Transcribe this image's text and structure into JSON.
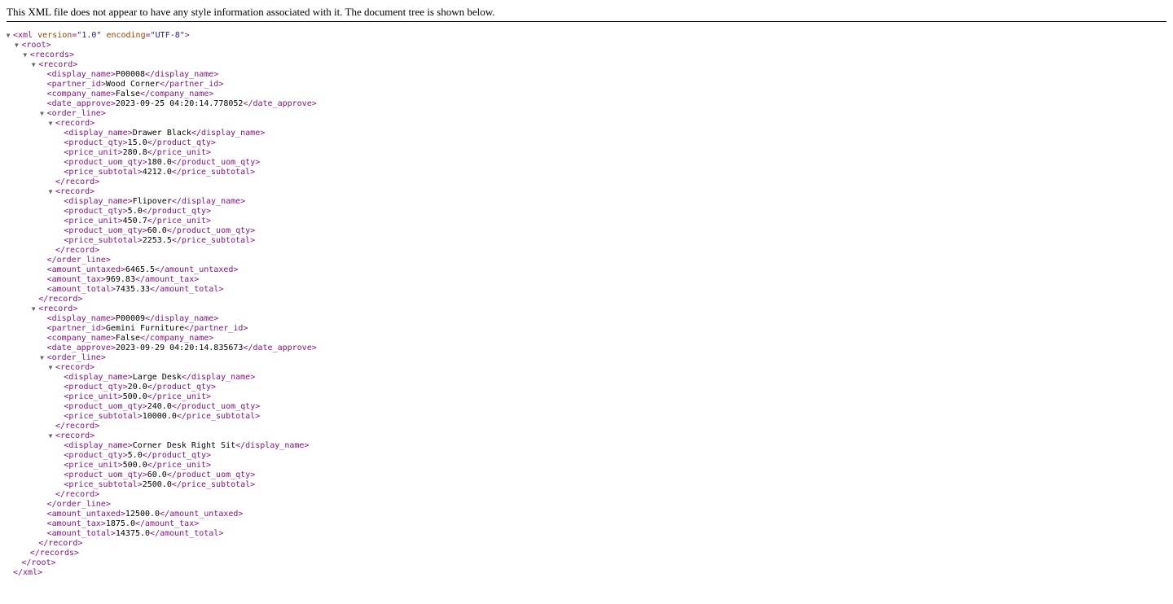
{
  "header": {
    "message": "This XML file does not appear to have any style information associated with it. The document tree is shown below."
  },
  "colors": {
    "tag": "#881280",
    "attribute_name": "#994500",
    "attribute_value": "#1a1aa6",
    "text": "#000000",
    "toggle_arrow": "#666666"
  },
  "icons": {
    "expanded_toggle": "expanded-triangle-icon"
  },
  "toggle_glyph": "▼",
  "lines": [
    {
      "depth": 0,
      "toggle": true,
      "parts": [
        {
          "t": "tag",
          "v": "<xml "
        },
        {
          "t": "attr-name",
          "v": "version"
        },
        {
          "t": "tag",
          "v": "="
        },
        {
          "t": "attr-value",
          "v": "\"1.0\""
        },
        {
          "t": "tag",
          "v": " "
        },
        {
          "t": "attr-name",
          "v": "encoding"
        },
        {
          "t": "tag",
          "v": "="
        },
        {
          "t": "attr-value",
          "v": "\"UTF-8\""
        },
        {
          "t": "tag",
          "v": ">"
        }
      ]
    },
    {
      "depth": 1,
      "toggle": true,
      "parts": [
        {
          "t": "tag",
          "v": "<root>"
        }
      ]
    },
    {
      "depth": 2,
      "toggle": true,
      "parts": [
        {
          "t": "tag",
          "v": "<records>"
        }
      ]
    },
    {
      "depth": 3,
      "toggle": true,
      "parts": [
        {
          "t": "tag",
          "v": "<record>"
        }
      ]
    },
    {
      "depth": 4,
      "toggle": false,
      "parts": [
        {
          "t": "tag",
          "v": "<display_name>"
        },
        {
          "t": "text",
          "v": "P00008"
        },
        {
          "t": "tag",
          "v": "</display_name>"
        }
      ]
    },
    {
      "depth": 4,
      "toggle": false,
      "parts": [
        {
          "t": "tag",
          "v": "<partner_id>"
        },
        {
          "t": "text",
          "v": "Wood Corner"
        },
        {
          "t": "tag",
          "v": "</partner_id>"
        }
      ]
    },
    {
      "depth": 4,
      "toggle": false,
      "parts": [
        {
          "t": "tag",
          "v": "<company_name>"
        },
        {
          "t": "text",
          "v": "False"
        },
        {
          "t": "tag",
          "v": "</company_name>"
        }
      ]
    },
    {
      "depth": 4,
      "toggle": false,
      "parts": [
        {
          "t": "tag",
          "v": "<date_approve>"
        },
        {
          "t": "text",
          "v": "2023-09-25 04:20:14.778052"
        },
        {
          "t": "tag",
          "v": "</date_approve>"
        }
      ]
    },
    {
      "depth": 4,
      "toggle": true,
      "parts": [
        {
          "t": "tag",
          "v": "<order_line>"
        }
      ]
    },
    {
      "depth": 5,
      "toggle": true,
      "parts": [
        {
          "t": "tag",
          "v": "<record>"
        }
      ]
    },
    {
      "depth": 6,
      "toggle": false,
      "parts": [
        {
          "t": "tag",
          "v": "<display_name>"
        },
        {
          "t": "text",
          "v": "Drawer Black"
        },
        {
          "t": "tag",
          "v": "</display_name>"
        }
      ]
    },
    {
      "depth": 6,
      "toggle": false,
      "parts": [
        {
          "t": "tag",
          "v": "<product_qty>"
        },
        {
          "t": "text",
          "v": "15.0"
        },
        {
          "t": "tag",
          "v": "</product_qty>"
        }
      ]
    },
    {
      "depth": 6,
      "toggle": false,
      "parts": [
        {
          "t": "tag",
          "v": "<price_unit>"
        },
        {
          "t": "text",
          "v": "280.8"
        },
        {
          "t": "tag",
          "v": "</price_unit>"
        }
      ]
    },
    {
      "depth": 6,
      "toggle": false,
      "parts": [
        {
          "t": "tag",
          "v": "<product_uom_qty>"
        },
        {
          "t": "text",
          "v": "180.0"
        },
        {
          "t": "tag",
          "v": "</product_uom_qty>"
        }
      ]
    },
    {
      "depth": 6,
      "toggle": false,
      "parts": [
        {
          "t": "tag",
          "v": "<price_subtotal>"
        },
        {
          "t": "text",
          "v": "4212.0"
        },
        {
          "t": "tag",
          "v": "</price_subtotal>"
        }
      ]
    },
    {
      "depth": 5,
      "toggle": false,
      "parts": [
        {
          "t": "tag",
          "v": "</record>"
        }
      ]
    },
    {
      "depth": 5,
      "toggle": true,
      "parts": [
        {
          "t": "tag",
          "v": "<record>"
        }
      ]
    },
    {
      "depth": 6,
      "toggle": false,
      "parts": [
        {
          "t": "tag",
          "v": "<display_name>"
        },
        {
          "t": "text",
          "v": "Flipover"
        },
        {
          "t": "tag",
          "v": "</display_name>"
        }
      ]
    },
    {
      "depth": 6,
      "toggle": false,
      "parts": [
        {
          "t": "tag",
          "v": "<product_qty>"
        },
        {
          "t": "text",
          "v": "5.0"
        },
        {
          "t": "tag",
          "v": "</product_qty>"
        }
      ]
    },
    {
      "depth": 6,
      "toggle": false,
      "parts": [
        {
          "t": "tag",
          "v": "<price_unit>"
        },
        {
          "t": "text",
          "v": "450.7"
        },
        {
          "t": "tag",
          "v": "</price_unit>"
        }
      ]
    },
    {
      "depth": 6,
      "toggle": false,
      "parts": [
        {
          "t": "tag",
          "v": "<product_uom_qty>"
        },
        {
          "t": "text",
          "v": "60.0"
        },
        {
          "t": "tag",
          "v": "</product_uom_qty>"
        }
      ]
    },
    {
      "depth": 6,
      "toggle": false,
      "parts": [
        {
          "t": "tag",
          "v": "<price_subtotal>"
        },
        {
          "t": "text",
          "v": "2253.5"
        },
        {
          "t": "tag",
          "v": "</price_subtotal>"
        }
      ]
    },
    {
      "depth": 5,
      "toggle": false,
      "parts": [
        {
          "t": "tag",
          "v": "</record>"
        }
      ]
    },
    {
      "depth": 4,
      "toggle": false,
      "parts": [
        {
          "t": "tag",
          "v": "</order_line>"
        }
      ]
    },
    {
      "depth": 4,
      "toggle": false,
      "parts": [
        {
          "t": "tag",
          "v": "<amount_untaxed>"
        },
        {
          "t": "text",
          "v": "6465.5"
        },
        {
          "t": "tag",
          "v": "</amount_untaxed>"
        }
      ]
    },
    {
      "depth": 4,
      "toggle": false,
      "parts": [
        {
          "t": "tag",
          "v": "<amount_tax>"
        },
        {
          "t": "text",
          "v": "969.83"
        },
        {
          "t": "tag",
          "v": "</amount_tax>"
        }
      ]
    },
    {
      "depth": 4,
      "toggle": false,
      "parts": [
        {
          "t": "tag",
          "v": "<amount_total>"
        },
        {
          "t": "text",
          "v": "7435.33"
        },
        {
          "t": "tag",
          "v": "</amount_total>"
        }
      ]
    },
    {
      "depth": 3,
      "toggle": false,
      "parts": [
        {
          "t": "tag",
          "v": "</record>"
        }
      ]
    },
    {
      "depth": 3,
      "toggle": true,
      "parts": [
        {
          "t": "tag",
          "v": "<record>"
        }
      ]
    },
    {
      "depth": 4,
      "toggle": false,
      "parts": [
        {
          "t": "tag",
          "v": "<display_name>"
        },
        {
          "t": "text",
          "v": "P00009"
        },
        {
          "t": "tag",
          "v": "</display_name>"
        }
      ]
    },
    {
      "depth": 4,
      "toggle": false,
      "parts": [
        {
          "t": "tag",
          "v": "<partner_id>"
        },
        {
          "t": "text",
          "v": "Gemini Furniture"
        },
        {
          "t": "tag",
          "v": "</partner_id>"
        }
      ]
    },
    {
      "depth": 4,
      "toggle": false,
      "parts": [
        {
          "t": "tag",
          "v": "<company_name>"
        },
        {
          "t": "text",
          "v": "False"
        },
        {
          "t": "tag",
          "v": "</company_name>"
        }
      ]
    },
    {
      "depth": 4,
      "toggle": false,
      "parts": [
        {
          "t": "tag",
          "v": "<date_approve>"
        },
        {
          "t": "text",
          "v": "2023-09-29 04:20:14.835673"
        },
        {
          "t": "tag",
          "v": "</date_approve>"
        }
      ]
    },
    {
      "depth": 4,
      "toggle": true,
      "parts": [
        {
          "t": "tag",
          "v": "<order_line>"
        }
      ]
    },
    {
      "depth": 5,
      "toggle": true,
      "parts": [
        {
          "t": "tag",
          "v": "<record>"
        }
      ]
    },
    {
      "depth": 6,
      "toggle": false,
      "parts": [
        {
          "t": "tag",
          "v": "<display_name>"
        },
        {
          "t": "text",
          "v": "Large Desk"
        },
        {
          "t": "tag",
          "v": "</display_name>"
        }
      ]
    },
    {
      "depth": 6,
      "toggle": false,
      "parts": [
        {
          "t": "tag",
          "v": "<product_qty>"
        },
        {
          "t": "text",
          "v": "20.0"
        },
        {
          "t": "tag",
          "v": "</product_qty>"
        }
      ]
    },
    {
      "depth": 6,
      "toggle": false,
      "parts": [
        {
          "t": "tag",
          "v": "<price_unit>"
        },
        {
          "t": "text",
          "v": "500.0"
        },
        {
          "t": "tag",
          "v": "</price_unit>"
        }
      ]
    },
    {
      "depth": 6,
      "toggle": false,
      "parts": [
        {
          "t": "tag",
          "v": "<product_uom_qty>"
        },
        {
          "t": "text",
          "v": "240.0"
        },
        {
          "t": "tag",
          "v": "</product_uom_qty>"
        }
      ]
    },
    {
      "depth": 6,
      "toggle": false,
      "parts": [
        {
          "t": "tag",
          "v": "<price_subtotal>"
        },
        {
          "t": "text",
          "v": "10000.0"
        },
        {
          "t": "tag",
          "v": "</price_subtotal>"
        }
      ]
    },
    {
      "depth": 5,
      "toggle": false,
      "parts": [
        {
          "t": "tag",
          "v": "</record>"
        }
      ]
    },
    {
      "depth": 5,
      "toggle": true,
      "parts": [
        {
          "t": "tag",
          "v": "<record>"
        }
      ]
    },
    {
      "depth": 6,
      "toggle": false,
      "parts": [
        {
          "t": "tag",
          "v": "<display_name>"
        },
        {
          "t": "text",
          "v": "Corner Desk Right Sit"
        },
        {
          "t": "tag",
          "v": "</display_name>"
        }
      ]
    },
    {
      "depth": 6,
      "toggle": false,
      "parts": [
        {
          "t": "tag",
          "v": "<product_qty>"
        },
        {
          "t": "text",
          "v": "5.0"
        },
        {
          "t": "tag",
          "v": "</product_qty>"
        }
      ]
    },
    {
      "depth": 6,
      "toggle": false,
      "parts": [
        {
          "t": "tag",
          "v": "<price_unit>"
        },
        {
          "t": "text",
          "v": "500.0"
        },
        {
          "t": "tag",
          "v": "</price_unit>"
        }
      ]
    },
    {
      "depth": 6,
      "toggle": false,
      "parts": [
        {
          "t": "tag",
          "v": "<product_uom_qty>"
        },
        {
          "t": "text",
          "v": "60.0"
        },
        {
          "t": "tag",
          "v": "</product_uom_qty>"
        }
      ]
    },
    {
      "depth": 6,
      "toggle": false,
      "parts": [
        {
          "t": "tag",
          "v": "<price_subtotal>"
        },
        {
          "t": "text",
          "v": "2500.0"
        },
        {
          "t": "tag",
          "v": "</price_subtotal>"
        }
      ]
    },
    {
      "depth": 5,
      "toggle": false,
      "parts": [
        {
          "t": "tag",
          "v": "</record>"
        }
      ]
    },
    {
      "depth": 4,
      "toggle": false,
      "parts": [
        {
          "t": "tag",
          "v": "</order_line>"
        }
      ]
    },
    {
      "depth": 4,
      "toggle": false,
      "parts": [
        {
          "t": "tag",
          "v": "<amount_untaxed>"
        },
        {
          "t": "text",
          "v": "12500.0"
        },
        {
          "t": "tag",
          "v": "</amount_untaxed>"
        }
      ]
    },
    {
      "depth": 4,
      "toggle": false,
      "parts": [
        {
          "t": "tag",
          "v": "<amount_tax>"
        },
        {
          "t": "text",
          "v": "1875.0"
        },
        {
          "t": "tag",
          "v": "</amount_tax>"
        }
      ]
    },
    {
      "depth": 4,
      "toggle": false,
      "parts": [
        {
          "t": "tag",
          "v": "<amount_total>"
        },
        {
          "t": "text",
          "v": "14375.0"
        },
        {
          "t": "tag",
          "v": "</amount_total>"
        }
      ]
    },
    {
      "depth": 3,
      "toggle": false,
      "parts": [
        {
          "t": "tag",
          "v": "</record>"
        }
      ]
    },
    {
      "depth": 2,
      "toggle": false,
      "parts": [
        {
          "t": "tag",
          "v": "</records>"
        }
      ]
    },
    {
      "depth": 1,
      "toggle": false,
      "parts": [
        {
          "t": "tag",
          "v": "</root>"
        }
      ]
    },
    {
      "depth": 0,
      "toggle": false,
      "parts": [
        {
          "t": "tag",
          "v": "</xml>"
        }
      ]
    }
  ]
}
